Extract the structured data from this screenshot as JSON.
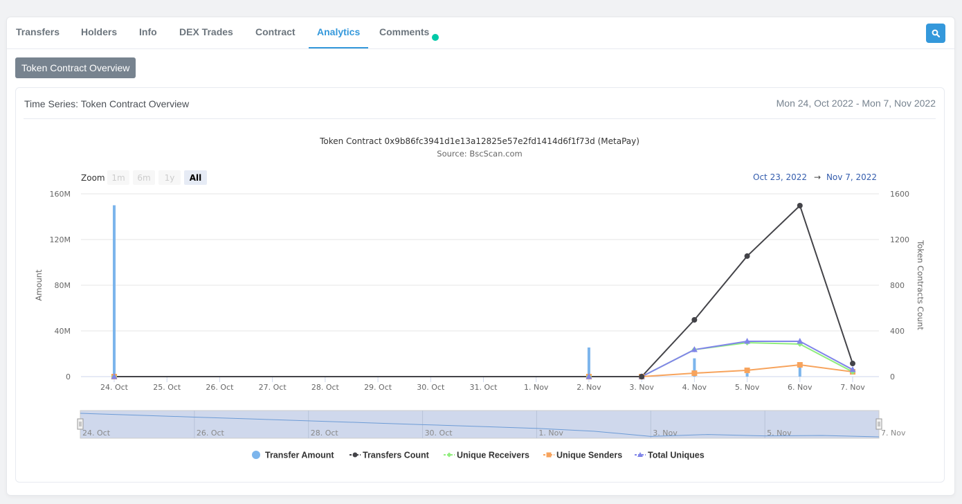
{
  "tabs": [
    {
      "label": "Transfers",
      "active": false
    },
    {
      "label": "Holders",
      "active": false
    },
    {
      "label": "Info",
      "active": false
    },
    {
      "label": "DEX Trades",
      "active": false
    },
    {
      "label": "Contract",
      "active": false
    },
    {
      "label": "Analytics",
      "active": true
    },
    {
      "label": "Comments",
      "active": false,
      "has_dot": true
    }
  ],
  "search_icon": "search-icon",
  "overview_button": "Token Contract Overview",
  "panel": {
    "title": "Time Series: Token Contract Overview",
    "date_range": "Mon 24, Oct 2022 - Mon 7, Nov 2022"
  },
  "colors": {
    "accent": "#3498db",
    "comment_dot": "#00c9a7",
    "transfer_amount": "#7cb5ec",
    "transfers_count": "#434348",
    "unique_receivers": "#90ed7d",
    "unique_senders": "#f7a35c",
    "total_uniques": "#8085e9"
  },
  "chart_data": {
    "type": "bar+line",
    "title": "Token Contract 0x9b86fc3941d1e13a12825e57e2fd1414d6f1f73d (MetaPay)",
    "subtitle": "Source: BscScan.com",
    "zoom_label": "Zoom",
    "zoom_buttons": [
      {
        "label": "1m",
        "enabled": false,
        "selected": false
      },
      {
        "label": "6m",
        "enabled": false,
        "selected": false
      },
      {
        "label": "1y",
        "enabled": false,
        "selected": false
      },
      {
        "label": "All",
        "enabled": true,
        "selected": true
      }
    ],
    "range_from": "Oct 23, 2022",
    "range_arrow": "→",
    "range_to": "Nov 7, 2022",
    "categories": [
      "24. Oct",
      "25. Oct",
      "26. Oct",
      "27. Oct",
      "28. Oct",
      "29. Oct",
      "30. Oct",
      "31. Oct",
      "1. Nov",
      "2. Nov",
      "3. Nov",
      "4. Nov",
      "5. Nov",
      "6. Nov",
      "7. Nov"
    ],
    "ylabel_left": "Amount",
    "ylabel_right": "Token Contracts Count",
    "ylim_left": [
      0,
      160000000
    ],
    "ylim_right": [
      0,
      1600
    ],
    "yticks_left": [
      "0",
      "40M",
      "80M",
      "120M",
      "160M"
    ],
    "yticks_right": [
      "0",
      "400",
      "800",
      "1200",
      "1600"
    ],
    "grid": true,
    "legend_position": "bottom",
    "series": [
      {
        "name": "Transfer Amount",
        "type": "column",
        "axis": "left",
        "values": [
          150000000,
          0,
          0,
          0,
          0,
          0,
          0,
          0,
          0,
          25500000,
          0,
          16000000,
          3000000,
          9000000,
          0
        ]
      },
      {
        "name": "Transfers Count",
        "type": "line",
        "axis": "right",
        "marker": "circle",
        "values": [
          0,
          0,
          0,
          0,
          0,
          0,
          0,
          0,
          0,
          0,
          0,
          497,
          1055,
          1497,
          115
        ]
      },
      {
        "name": "Unique Receivers",
        "type": "line",
        "axis": "right",
        "marker": "diamond",
        "values": [
          0,
          0,
          0,
          0,
          0,
          0,
          0,
          0,
          0,
          0,
          0,
          236,
          297,
          285,
          42
        ]
      },
      {
        "name": "Unique Senders",
        "type": "line",
        "axis": "right",
        "marker": "square",
        "values": [
          0,
          0,
          0,
          0,
          0,
          0,
          0,
          0,
          0,
          0,
          0,
          30,
          55,
          103,
          42
        ]
      },
      {
        "name": "Total Uniques",
        "type": "line",
        "axis": "right",
        "marker": "triangle",
        "values": [
          0,
          0,
          0,
          0,
          0,
          0,
          0,
          0,
          0,
          0,
          0,
          236,
          309,
          309,
          61
        ]
      }
    ],
    "navigator": {
      "labels": [
        "24. Oct",
        "26. Oct",
        "28. Oct",
        "30. Oct",
        "1. Nov",
        "3. Nov",
        "5. Nov",
        "7. Nov"
      ],
      "values": [
        1.0,
        0.92,
        0.84,
        0.76,
        0.68,
        0.6,
        0.52,
        0.44,
        0.36,
        0.24,
        0.02,
        0.1,
        0.04,
        0.06,
        0.0
      ]
    }
  }
}
